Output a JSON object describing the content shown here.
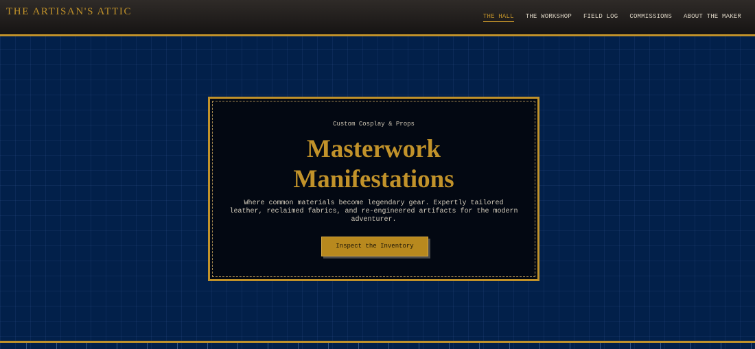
{
  "header": {
    "brand": "THE ARTISAN'S ATTIC",
    "nav": [
      {
        "label": "THE HALL",
        "active": true
      },
      {
        "label": "THE WORKSHOP",
        "active": false
      },
      {
        "label": "FIELD LOG",
        "active": false
      },
      {
        "label": "COMMISSIONS",
        "active": false
      },
      {
        "label": "ABOUT THE MAKER",
        "active": false
      }
    ]
  },
  "hero": {
    "eyebrow": "Custom Cosplay & Props",
    "headline_line1": "Masterwork",
    "headline_line2": "Manifestations",
    "description": "Where common materials become legendary gear. Expertly tailored leather, reclaimed fabrics, and re-engineered artifacts for the modern adventurer.",
    "cta_label": "Inspect the Inventory"
  },
  "colors": {
    "accent_gold": "#c1922a",
    "background_navy": "#02204a",
    "header_dark": "#1e1b19",
    "card_black": "#030812"
  }
}
